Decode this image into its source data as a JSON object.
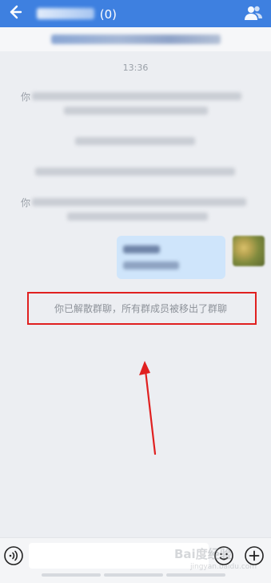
{
  "header": {
    "title_suffix": "(0)",
    "back_icon": "back-arrow-icon",
    "members_icon": "group-members-icon",
    "background_color": "#3e80e0"
  },
  "chat": {
    "timestamp": "13:36",
    "system_prefix_1": "你",
    "system_prefix_2": "你",
    "dissolved_notice": "你已解散群聊，所有群成员被移出了群聊"
  },
  "annotation": {
    "box_color": "#e02020",
    "arrow_color": "#e02020"
  },
  "input_bar": {
    "placeholder": "",
    "voice_icon": "voice-icon",
    "emoji_icon": "emoji-icon",
    "plus_icon": "plus-icon"
  },
  "watermark": {
    "main": "Bai度经验",
    "sub": "jingyan.baidu.com"
  }
}
